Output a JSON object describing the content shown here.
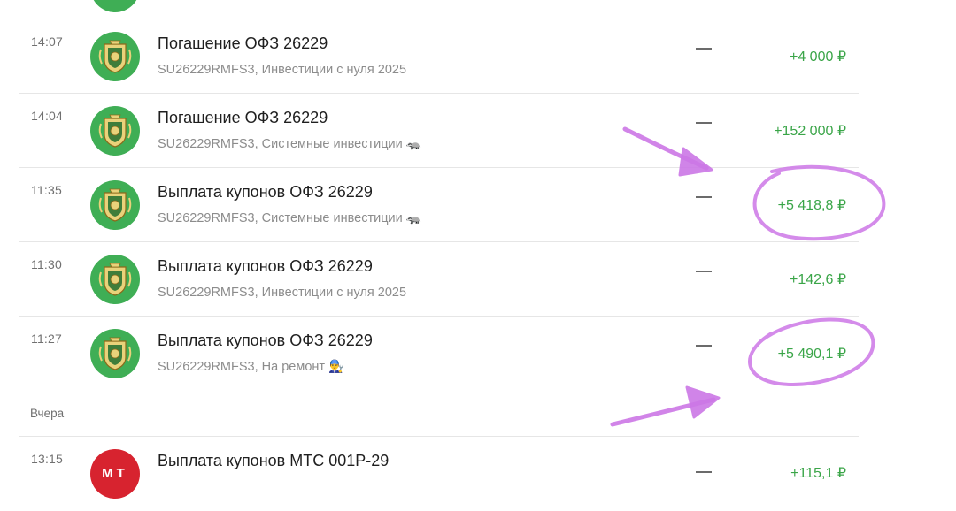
{
  "colors": {
    "income_green": "#3aa548",
    "ofz_avatar": "#3fae55",
    "mts_avatar": "#d7232f",
    "annotation": "#cc77e6"
  },
  "top_partial_row": {
    "icon": "ofz-emblem-icon"
  },
  "operations": [
    {
      "time": "14:07",
      "title": "Погашение ОФЗ 26229",
      "subtitle": "SU26229RMFS3, Инвестиции с нуля 2025",
      "emoji": "",
      "dash": "—",
      "amount": "+4 000 ₽",
      "icon": "ofz-emblem-icon"
    },
    {
      "time": "14:04",
      "title": "Погашение ОФЗ 26229",
      "subtitle": "SU26229RMFS3, Системные инвестиции",
      "emoji": "🦡",
      "dash": "—",
      "amount": "+152 000 ₽",
      "icon": "ofz-emblem-icon"
    },
    {
      "time": "11:35",
      "title": "Выплата купонов ОФЗ 26229",
      "subtitle": "SU26229RMFS3, Системные инвестиции",
      "emoji": "🦡",
      "dash": "—",
      "amount": "+5 418,8 ₽",
      "icon": "ofz-emblem-icon"
    },
    {
      "time": "11:30",
      "title": "Выплата купонов ОФЗ 26229",
      "subtitle": "SU26229RMFS3, Инвестиции с нуля 2025",
      "emoji": "",
      "dash": "—",
      "amount": "+142,6 ₽",
      "icon": "ofz-emblem-icon"
    },
    {
      "time": "11:27",
      "title": "Выплата купонов ОФЗ 26229",
      "subtitle": "SU26229RMFS3, На ремонт",
      "emoji": "👨‍🔧",
      "dash": "—",
      "amount": "+5 490,1 ₽",
      "icon": "ofz-emblem-icon"
    }
  ],
  "section_yesterday": {
    "label": "Вчера"
  },
  "yesterday_operations": [
    {
      "time": "13:15",
      "title": "Выплата купонов МТС 001Р-29",
      "avatar_text": "МТ",
      "dash": "—",
      "amount": "+115,1 ₽",
      "icon": "mts-logo-icon"
    }
  ]
}
